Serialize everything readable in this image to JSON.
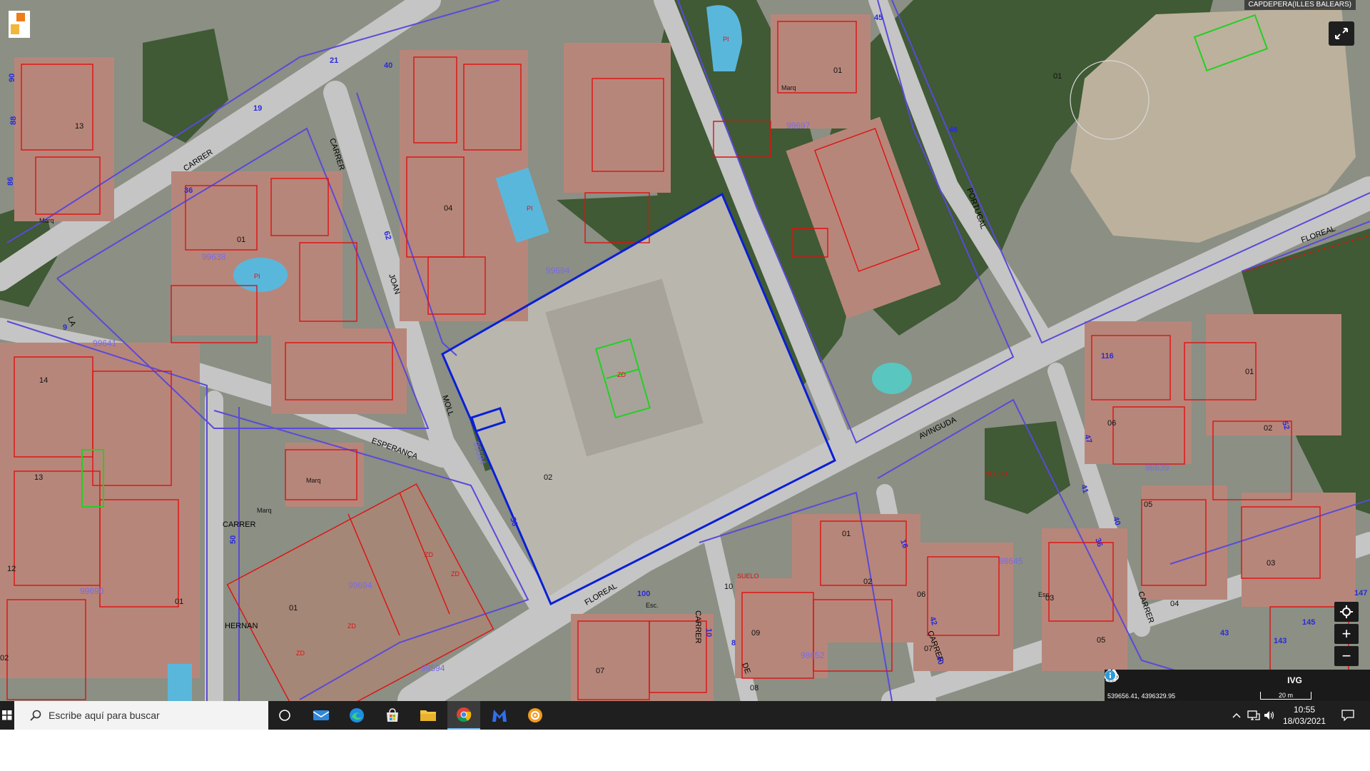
{
  "map": {
    "region": "CAPDEPERA(ILLES BALEARS)",
    "coordinates": "539656.41, 4396329.95",
    "scale": "20 m",
    "streets": [
      {
        "name": "CARRER"
      },
      {
        "name": "CARRER"
      },
      {
        "name": "JOAN"
      },
      {
        "name": "MOLL"
      },
      {
        "name": "ESPERANÇA"
      },
      {
        "name": "LA"
      },
      {
        "name": "CARRER"
      },
      {
        "name": "HERNAN"
      },
      {
        "name": "AVINGUDA"
      },
      {
        "name": "FLOREAL"
      },
      {
        "name": "FLOREAL"
      },
      {
        "name": "CARRER"
      },
      {
        "name": "DE"
      },
      {
        "name": "CARRER"
      },
      {
        "name": "CARRER"
      },
      {
        "name": "PORTUGAL"
      }
    ],
    "parcel_numbers": [
      {
        "text": "01"
      },
      {
        "text": "02"
      },
      {
        "text": "04"
      },
      {
        "text": "01"
      },
      {
        "text": "01"
      },
      {
        "text": "13"
      },
      {
        "text": "13"
      },
      {
        "text": "12"
      },
      {
        "text": "14"
      },
      {
        "text": "01"
      },
      {
        "text": "02"
      },
      {
        "text": "01"
      },
      {
        "text": "03"
      },
      {
        "text": "05"
      },
      {
        "text": "06"
      },
      {
        "text": "04"
      },
      {
        "text": "07"
      },
      {
        "text": "09"
      },
      {
        "text": "10"
      },
      {
        "text": "03"
      },
      {
        "text": "05"
      },
      {
        "text": "06"
      },
      {
        "text": "07"
      },
      {
        "text": "08"
      },
      {
        "text": "01"
      },
      {
        "text": "02"
      },
      {
        "text": "01"
      },
      {
        "text": "02"
      }
    ],
    "block_ids": [
      {
        "text": "99694"
      },
      {
        "text": "99697"
      },
      {
        "text": "99694"
      },
      {
        "text": "99694"
      },
      {
        "text": "98639"
      },
      {
        "text": "98645"
      },
      {
        "text": "98652"
      },
      {
        "text": "99690"
      },
      {
        "text": "99638"
      },
      {
        "text": "99641"
      },
      {
        "text": "99594"
      }
    ],
    "street_numbers": [
      {
        "text": "90"
      },
      {
        "text": "88"
      },
      {
        "text": "86"
      },
      {
        "text": "19"
      },
      {
        "text": "21"
      },
      {
        "text": "40"
      },
      {
        "text": "36"
      },
      {
        "text": "62"
      },
      {
        "text": "56"
      },
      {
        "text": "45"
      },
      {
        "text": "46"
      },
      {
        "text": "116"
      },
      {
        "text": "47"
      },
      {
        "text": "36"
      },
      {
        "text": "52"
      },
      {
        "text": "41"
      },
      {
        "text": "40"
      },
      {
        "text": "43"
      },
      {
        "text": "145"
      },
      {
        "text": "143"
      },
      {
        "text": "147"
      },
      {
        "text": "100"
      },
      {
        "text": "16"
      },
      {
        "text": "42"
      },
      {
        "text": "40"
      },
      {
        "text": "8"
      },
      {
        "text": "10"
      },
      {
        "text": "50"
      },
      {
        "text": "9"
      }
    ],
    "feature_labels": [
      {
        "text": "PI"
      },
      {
        "text": "PI"
      },
      {
        "text": "PI"
      },
      {
        "text": "ZD"
      },
      {
        "text": "ZD"
      },
      {
        "text": "ZD"
      },
      {
        "text": "ZD"
      },
      {
        "text": "ZD"
      },
      {
        "text": "SUELO"
      },
      {
        "text": "SUELO"
      },
      {
        "text": "Marq"
      },
      {
        "text": "Marq"
      },
      {
        "text": "Marq"
      },
      {
        "text": "Marq"
      },
      {
        "text": "Esc."
      },
      {
        "text": "Esc."
      }
    ]
  },
  "toolbar": {
    "items": [
      {
        "icon": "chevron-right-icon",
        "label": ""
      },
      {
        "icon": "search-icon",
        "label": ""
      },
      {
        "icon": "layers-icon",
        "label": ""
      },
      {
        "icon": "measure-icon",
        "label": ""
      },
      {
        "icon": "print-icon",
        "label": ""
      },
      {
        "icon": "street-view-icon",
        "label": ""
      },
      {
        "icon": "ivg-icon",
        "label": "IVG"
      },
      {
        "icon": "binoculars-icon",
        "label": ""
      },
      {
        "icon": "info-icon",
        "label": ""
      }
    ]
  },
  "zoom": {
    "in": "+",
    "out": "−"
  },
  "taskbar": {
    "search_placeholder": "Escribe aquí para buscar",
    "time": "10:55",
    "date": "18/03/2021"
  },
  "colors": {
    "parcel": "#e01010",
    "block": "#5a4ad8",
    "selection": "#0a1fd6",
    "court": "#22d022"
  }
}
